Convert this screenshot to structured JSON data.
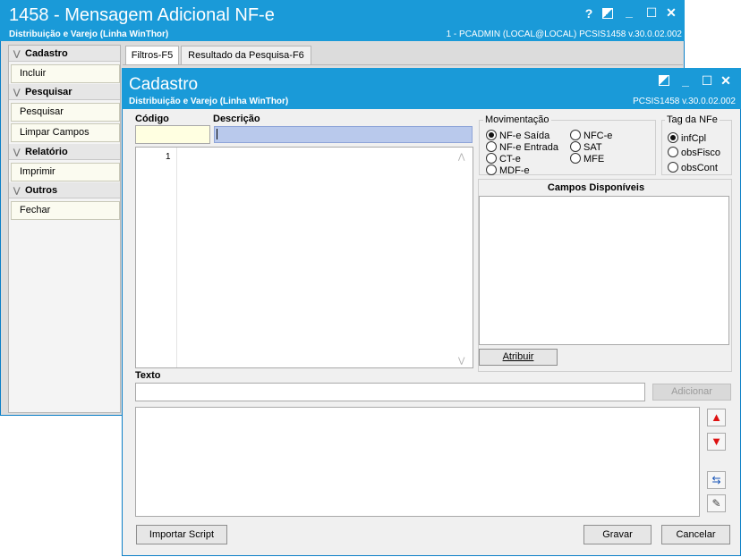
{
  "main_window": {
    "title": "1458 - Mensagem Adicional NF-e",
    "subtitle": "Distribuição e Varejo (Linha WinThor)",
    "status_right": "1 - PCADMIN (LOCAL@LOCAL)   PCSIS1458  v.30.0.02.002",
    "controls": {
      "help": "?",
      "minimize": "_",
      "maximize": "☐",
      "close": "✕"
    }
  },
  "sidebar": {
    "sections": [
      {
        "title": "Cadastro",
        "items": [
          "Incluir"
        ]
      },
      {
        "title": "Pesquisar",
        "items": [
          "Pesquisar",
          "Limpar Campos"
        ]
      },
      {
        "title": "Relatório",
        "items": [
          "Imprimir"
        ]
      },
      {
        "title": "Outros",
        "items": [
          "Fechar"
        ]
      }
    ]
  },
  "tabs": [
    {
      "label": "Filtros-F5",
      "active": true
    },
    {
      "label": "Resultado da Pesquisa-F6",
      "active": false
    }
  ],
  "dialog": {
    "title": "Cadastro",
    "subtitle": "Distribuição e Varejo (Linha WinThor)",
    "version": "PCSIS1458  v.30.0.02.002",
    "codigo_label": "Código",
    "codigo_value": "",
    "descricao_label": "Descrição",
    "descricao_value": "",
    "editor_line": "1",
    "movimentacao": {
      "title": "Movimentação",
      "options": [
        "NF-e Saída",
        "NF-e Entrada",
        "CT-e",
        "MDF-e",
        "NFC-e",
        "SAT",
        "MFE"
      ],
      "selected": "NF-e Saída"
    },
    "tag_nfe": {
      "title": "Tag da NFe",
      "options": [
        "infCpl",
        "obsFisco",
        "obsCont"
      ],
      "selected": "infCpl"
    },
    "campos_title": "Campos Disponíveis",
    "atribuir_label": "Atribuir",
    "texto_label": "Texto",
    "texto_value": "",
    "adicionar_label": "Adicionar",
    "importar_label": "Importar Script",
    "gravar_label": "Gravar",
    "cancelar_label": "Cancelar"
  }
}
